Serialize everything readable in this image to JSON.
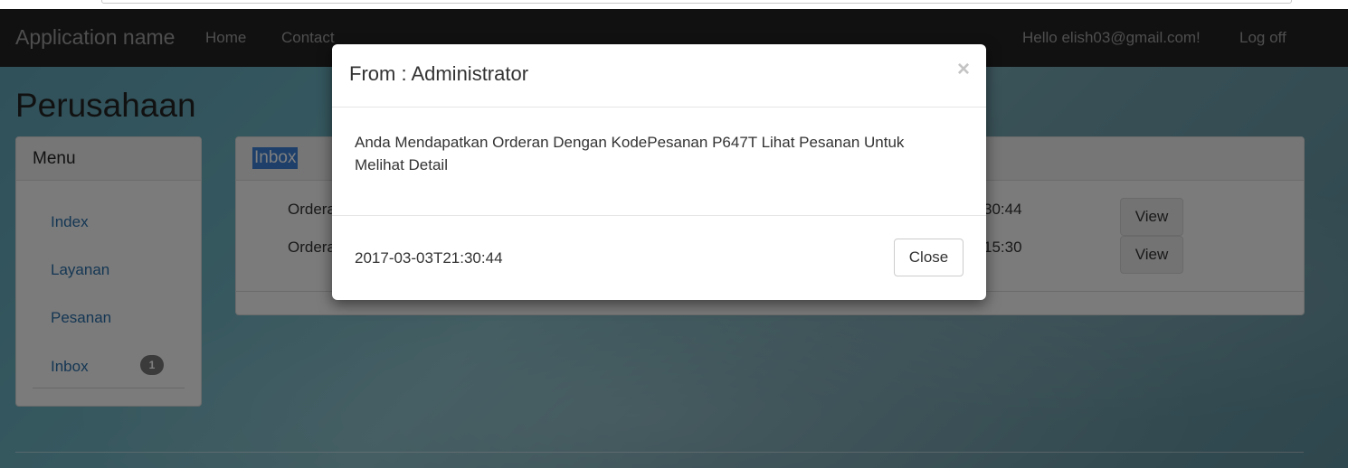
{
  "navbar": {
    "brand": "Application name",
    "home": "Home",
    "contact": "Contact",
    "hello": "Hello elish03@gmail.com!",
    "logoff": "Log off"
  },
  "page": {
    "title": "Perusahaan"
  },
  "menu": {
    "heading": "Menu",
    "items": [
      "Index",
      "Layanan",
      "Pesanan",
      "Inbox"
    ],
    "inbox_badge": "1"
  },
  "inbox": {
    "heading": "Inbox",
    "rows": [
      {
        "label": "Ordera",
        "time": "30:44",
        "button": "View"
      },
      {
        "label": "Ordera",
        "time": "15:30",
        "button": "View"
      }
    ]
  },
  "modal": {
    "title": "From : Administrator",
    "close_symbol": "×",
    "body": "Anda Mendapatkan Orderan Dengan KodePesanan P647T Lihat Pesanan Untuk Melihat Detail",
    "date": "2017-03-03T21:30:44",
    "close_label": "Close"
  }
}
